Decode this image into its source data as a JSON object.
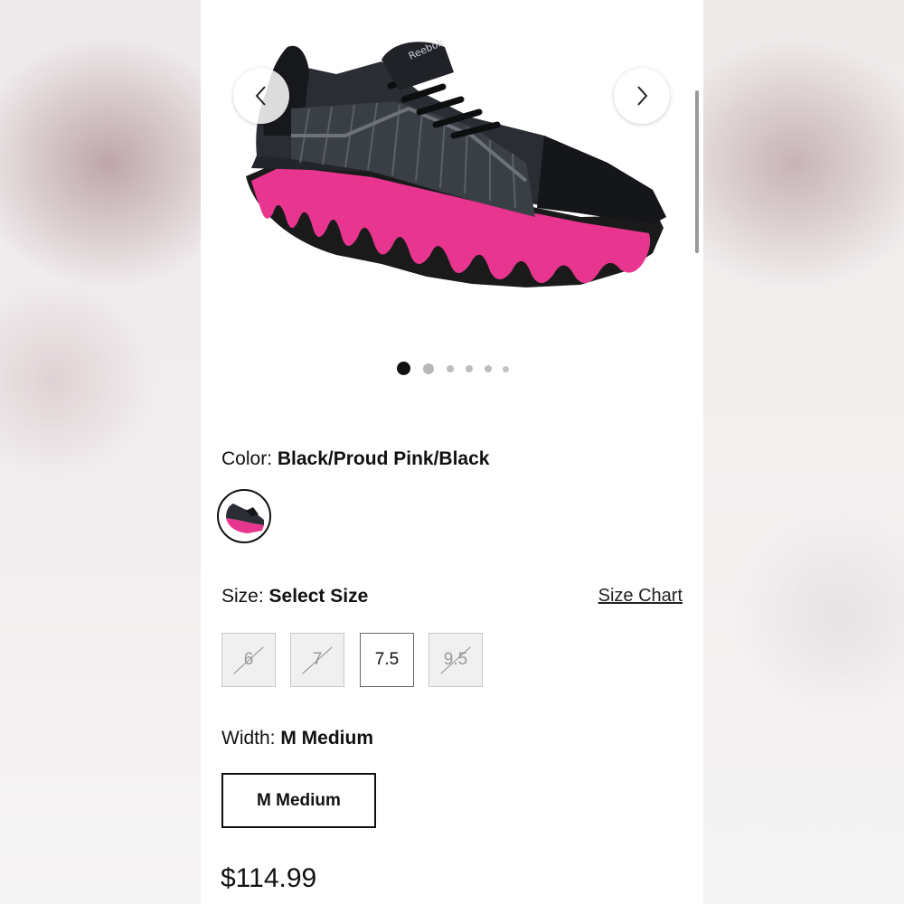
{
  "gallery": {
    "prev_icon": "chevron-left-icon",
    "next_icon": "chevron-right-icon",
    "total_images": 6,
    "active_index": 0,
    "brand_mark": "Reebok"
  },
  "color": {
    "label": "Color:",
    "value": "Black/Proud Pink/Black"
  },
  "size": {
    "label": "Size:",
    "value": "Select Size",
    "chart_link": "Size Chart",
    "options": [
      {
        "label": "6",
        "available": false
      },
      {
        "label": "7",
        "available": false
      },
      {
        "label": "7.5",
        "available": true
      },
      {
        "label": "9.5",
        "available": false
      }
    ]
  },
  "width": {
    "label": "Width:",
    "value": "M Medium",
    "option": "M Medium"
  },
  "price": "$114.99",
  "colors": {
    "upper": "#1b1d22",
    "overlay": "#3a3e45",
    "sole_pink": "#e8358f",
    "sole_dark": "#1a1a1a"
  }
}
